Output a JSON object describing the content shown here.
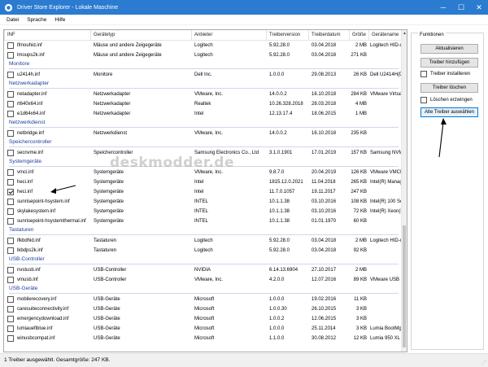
{
  "window": {
    "title": "Driver Store Explorer - Lokale Maschine",
    "minimize": "─",
    "maximize": "☐",
    "close": "✕"
  },
  "menu": [
    "Datei",
    "Sprache",
    "Hilfe"
  ],
  "columns": [
    "INF",
    "Gerätetyp",
    "Anbieter",
    "Treiberversion",
    "Treiberdatum",
    "Größe",
    "Gerätename"
  ],
  "sort_indicator": "^",
  "groups": [
    {
      "label": "",
      "rows": [
        {
          "checked": false,
          "inf": "lfmouhid.inf",
          "type": "Mäuse und andere Zeigegeräte",
          "vendor": "Logitech",
          "version": "5.92.28.0",
          "date": "03.04.2018",
          "size": "2 MB",
          "name": "Logitech HID-c"
        },
        {
          "checked": false,
          "inf": "lmoups2k.inf",
          "type": "Mäuse und andere Zeigegeräte",
          "vendor": "Logitech",
          "version": "5.92.28.0",
          "date": "03.04.2018",
          "size": "271 KB",
          "name": ""
        }
      ]
    },
    {
      "label": "Monitore",
      "rows": [
        {
          "checked": false,
          "inf": "u2414h.inf",
          "type": "Monitore",
          "vendor": "Dell Inc.",
          "version": "1.0.0.0",
          "date": "29.08.2013",
          "size": "26 KB",
          "name": "Dell U2414H(D"
        }
      ]
    },
    {
      "label": "Netzwerkadapter",
      "rows": [
        {
          "checked": false,
          "inf": "netadapter.inf",
          "type": "Netzwerkadapter",
          "vendor": "VMware, Inc.",
          "version": "14.0.0.2",
          "date": "16.10.2018",
          "size": "284 KB",
          "name": "VMware Virtual"
        },
        {
          "checked": false,
          "inf": "rt640x64.inf",
          "type": "Netzwerkadapter",
          "vendor": "Realtek",
          "version": "10.26.328.2018",
          "date": "28.03.2018",
          "size": "4 MB",
          "name": ""
        },
        {
          "checked": false,
          "inf": "e1d64x64.inf",
          "type": "Netzwerkadapter",
          "vendor": "Intel",
          "version": "12.13.17.4",
          "date": "18.06.2015",
          "size": "1 MB",
          "name": ""
        }
      ]
    },
    {
      "label": "Netzwerkdienst",
      "rows": [
        {
          "checked": false,
          "inf": "netbridge.inf",
          "type": "Netzwerkdienst",
          "vendor": "VMware, Inc.",
          "version": "14.0.0.2",
          "date": "16.10.2018",
          "size": "235 KB",
          "name": ""
        }
      ]
    },
    {
      "label": "Speichercontroller",
      "rows": [
        {
          "checked": false,
          "inf": "secnvme.inf",
          "type": "Speichercontroller",
          "vendor": "Samsung Electronics Co., Ltd",
          "version": "3.1.0.1901",
          "date": "17.01.2019",
          "size": "157 KB",
          "name": "Samsung NVMe"
        }
      ]
    },
    {
      "label": "Systemgeräte",
      "rows": [
        {
          "checked": false,
          "inf": "vmci.inf",
          "type": "Systemgeräte",
          "vendor": "VMware, Inc.",
          "version": "9.8.7.0",
          "date": "20.04.2019",
          "size": "126 KB",
          "name": "VMware VMCI"
        },
        {
          "checked": false,
          "inf": "heci.inf",
          "type": "Systemgeräte",
          "vendor": "Intel",
          "version": "1815.12.0.2021",
          "date": "11.04.2018",
          "size": "265 KB",
          "name": "Intel(R) Manag"
        },
        {
          "checked": true,
          "inf": "heci.inf",
          "type": "Systemgeräte",
          "vendor": "Intel",
          "version": "11.7.0.1057",
          "date": "19.11.2017",
          "size": "247 KB",
          "name": ""
        },
        {
          "checked": false,
          "inf": "sunrisepoint-hsystem.inf",
          "type": "Systemgeräte",
          "vendor": "INTEL",
          "version": "10.1.1.38",
          "date": "03.10.2016",
          "size": "108 KB",
          "name": "Intel(R) 100 Se"
        },
        {
          "checked": false,
          "inf": "skylakesystem.inf",
          "type": "Systemgeräte",
          "vendor": "INTEL",
          "version": "10.1.1.38",
          "date": "03.10.2016",
          "size": "72 KB",
          "name": "Intel(R) Xeon(R"
        },
        {
          "checked": false,
          "inf": "sunrisepoint-hsystemthermal.inf",
          "type": "Systemgeräte",
          "vendor": "INTEL",
          "version": "10.1.1.38",
          "date": "01.01.1970",
          "size": "60 KB",
          "name": ""
        }
      ]
    },
    {
      "label": "Tastaturen",
      "rows": [
        {
          "checked": false,
          "inf": "lfkbdhid.inf",
          "type": "Tastaturen",
          "vendor": "Logitech",
          "version": "5.92.28.0",
          "date": "03.04.2018",
          "size": "2 MB",
          "name": "Logitech HID-c"
        },
        {
          "checked": false,
          "inf": "lkbdps2k.inf",
          "type": "Tastaturen",
          "vendor": "Logitech",
          "version": "5.92.28.0",
          "date": "03.04.2018",
          "size": "92 KB",
          "name": ""
        }
      ]
    },
    {
      "label": "USB-Controller",
      "rows": [
        {
          "checked": false,
          "inf": "nvstusb.inf",
          "type": "USB-Controller",
          "vendor": "NVIDIA",
          "version": "6.14.13.6904",
          "date": "27.10.2017",
          "size": "2 MB",
          "name": ""
        },
        {
          "checked": false,
          "inf": "vmusb.inf",
          "type": "USB-Controller",
          "vendor": "VMware, Inc.",
          "version": "4.2.0.0",
          "date": "12.07.2016",
          "size": "89 KB",
          "name": "VMware USB xH"
        }
      ]
    },
    {
      "label": "USB-Geräte",
      "rows": [
        {
          "checked": false,
          "inf": "mobilerecovery.inf",
          "type": "USB-Geräte",
          "vendor": "Microsoft",
          "version": "1.0.0.0",
          "date": "19.02.2016",
          "size": "11 KB",
          "name": ""
        },
        {
          "checked": false,
          "inf": "caresuiteconnectivity.inf",
          "type": "USB-Geräte",
          "vendor": "Microsoft",
          "version": "1.0.0.30",
          "date": "26.10.2015",
          "size": "3 KB",
          "name": ""
        },
        {
          "checked": false,
          "inf": "emergencydownload.inf",
          "type": "USB-Geräte",
          "vendor": "Microsoft",
          "version": "1.0.0.2",
          "date": "12.06.2015",
          "size": "3 KB",
          "name": ""
        },
        {
          "checked": false,
          "inf": "lumiauefiblue.inf",
          "type": "USB-Geräte",
          "vendor": "Microsoft",
          "version": "1.0.0.0",
          "date": "25.11.2014",
          "size": "3 KB",
          "name": "Lumia BootMgr"
        },
        {
          "checked": false,
          "inf": "winusbcompat.inf",
          "type": "USB-Geräte",
          "vendor": "Microsoft",
          "version": "1.1.0.0",
          "date": "30.08.2012",
          "size": "12 KB",
          "name": "Lumia 950 XL ("
        }
      ]
    }
  ],
  "side_panel": {
    "legend": "Funktionen",
    "refresh": "Aktualisieren",
    "add_driver": "Treiber hinzufügen",
    "install_driver": "Treiber installieren",
    "delete_driver": "Treiber löschen",
    "force_delete": "Löschen erzwingen",
    "select_old": "Alte Treiber auswählen"
  },
  "watermark": "deskmodder.de",
  "status": "1 Treiber ausgewählt. Gesamtgröße: 247 KB.",
  "colors": {
    "titlebar": "#2b7bd0",
    "group_label": "#1e3e9e",
    "arrow": "#000000"
  }
}
